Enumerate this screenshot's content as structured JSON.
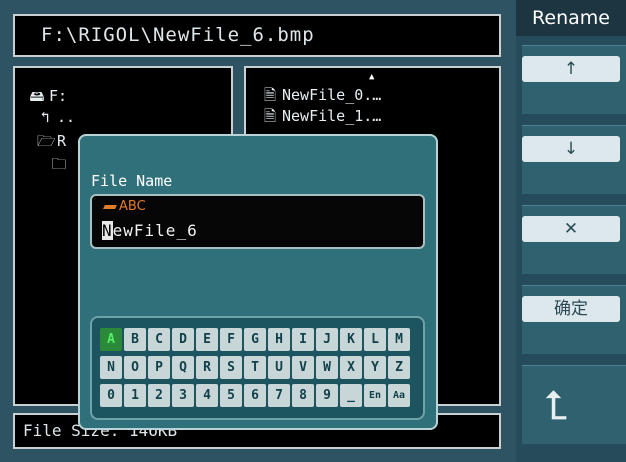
{
  "path": "F:\\RIGOL\\NewFile_6.bmp",
  "tree": [
    {
      "icon": "drive-icon",
      "glyph": "🖴",
      "label": "F:"
    },
    {
      "icon": "parent-folder-icon",
      "glyph": "↰",
      "label": ".."
    },
    {
      "icon": "open-folder-icon",
      "glyph": "🗁",
      "label": "R"
    },
    {
      "icon": "folder-icon",
      "glyph": "🗀",
      "label": ""
    }
  ],
  "files": [
    {
      "icon": "file-icon",
      "glyph": "🗎",
      "label": "NewFile_0.…"
    },
    {
      "icon": "file-icon",
      "glyph": "🗎",
      "label": "NewFile_1.…"
    }
  ],
  "status": "File Size: 146KB",
  "dialog": {
    "title": "File Name",
    "ime_mode": "ABC",
    "name_first": "N",
    "name_rest": "ewFile_6"
  },
  "keyboard": {
    "rows": [
      [
        "A",
        "B",
        "C",
        "D",
        "E",
        "F",
        "G",
        "H",
        "I",
        "J",
        "K",
        "L",
        "M"
      ],
      [
        "N",
        "O",
        "P",
        "Q",
        "R",
        "S",
        "T",
        "U",
        "V",
        "W",
        "X",
        "Y",
        "Z"
      ],
      [
        "0",
        "1",
        "2",
        "3",
        "4",
        "5",
        "6",
        "7",
        "8",
        "9",
        "_",
        "En",
        "Aa"
      ]
    ],
    "selected": "A"
  },
  "softkeys": {
    "title": "Rename",
    "up_icon": "↑",
    "down_icon": "↓",
    "delete_icon": "✕",
    "confirm_label": "确定",
    "back_icon": "⮤"
  }
}
